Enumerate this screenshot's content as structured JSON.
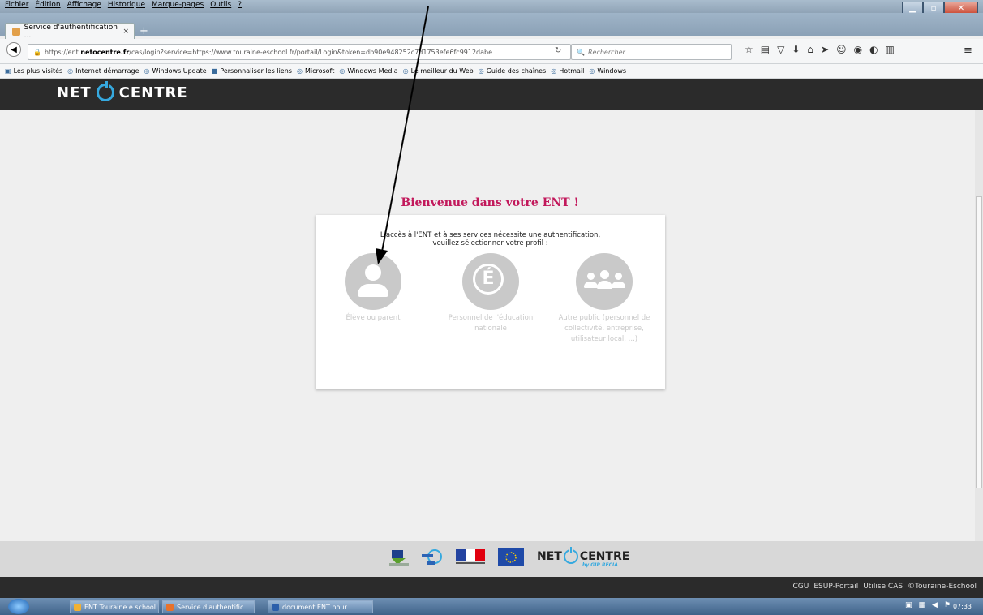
{
  "browser": {
    "menu": [
      "Fichier",
      "Édition",
      "Affichage",
      "Historique",
      "Marque-pages",
      "Outils",
      "?"
    ],
    "tab_title": "Service d'authentification ...",
    "tab_close": "×",
    "new_tab": "+",
    "url_prefix": "https://ent.",
    "url_domain": "netocentre.fr",
    "url_rest": "/cas/login?service=https://www.touraine-eschool.fr/portail/Login&token=db90e948252c7d1753efe6fc9912dabe",
    "search_placeholder": "Rechercher",
    "bookmarks": [
      "Les plus visités",
      "Internet démarrage",
      "Windows Update",
      "Personnaliser les liens",
      "Microsoft",
      "Windows Media",
      "Le meilleur du Web",
      "Guide des chaînes",
      "Hotmail",
      "Windows"
    ]
  },
  "site": {
    "logo_left": "NET",
    "logo_right": "CENTRE",
    "welcome": "Bienvenue dans votre ENT !",
    "intro_line1": "L'accès à l'ENT et à ses services nécessite une authentification,",
    "intro_line2": "veuillez sélectionner votre profil :",
    "profiles": [
      {
        "label": "Élève ou parent",
        "icon": "person-icon"
      },
      {
        "label": "Personnel de l'éducation nationale",
        "icon": "education-e-icon"
      },
      {
        "label": "Autre public (personnel de collectivité, entreprise, utilisateur local, ...)",
        "icon": "group-icon"
      }
    ],
    "footer_logo_left": "NET",
    "footer_logo_right": "CENTRE",
    "footer_logo_by": "by GIP RECIA",
    "footer_links": [
      "CGU",
      "ESUP-Portail",
      "Utilise CAS",
      "©Touraine-Eschool"
    ]
  },
  "taskbar": {
    "items": [
      "ENT Touraine e school",
      "Service d'authentific...",
      "document ENT pour ..."
    ],
    "clock": "07:33"
  },
  "colors": {
    "accent": "#c2185b",
    "brand_blue": "#36a9df",
    "header_bg": "#2b2b2b"
  }
}
